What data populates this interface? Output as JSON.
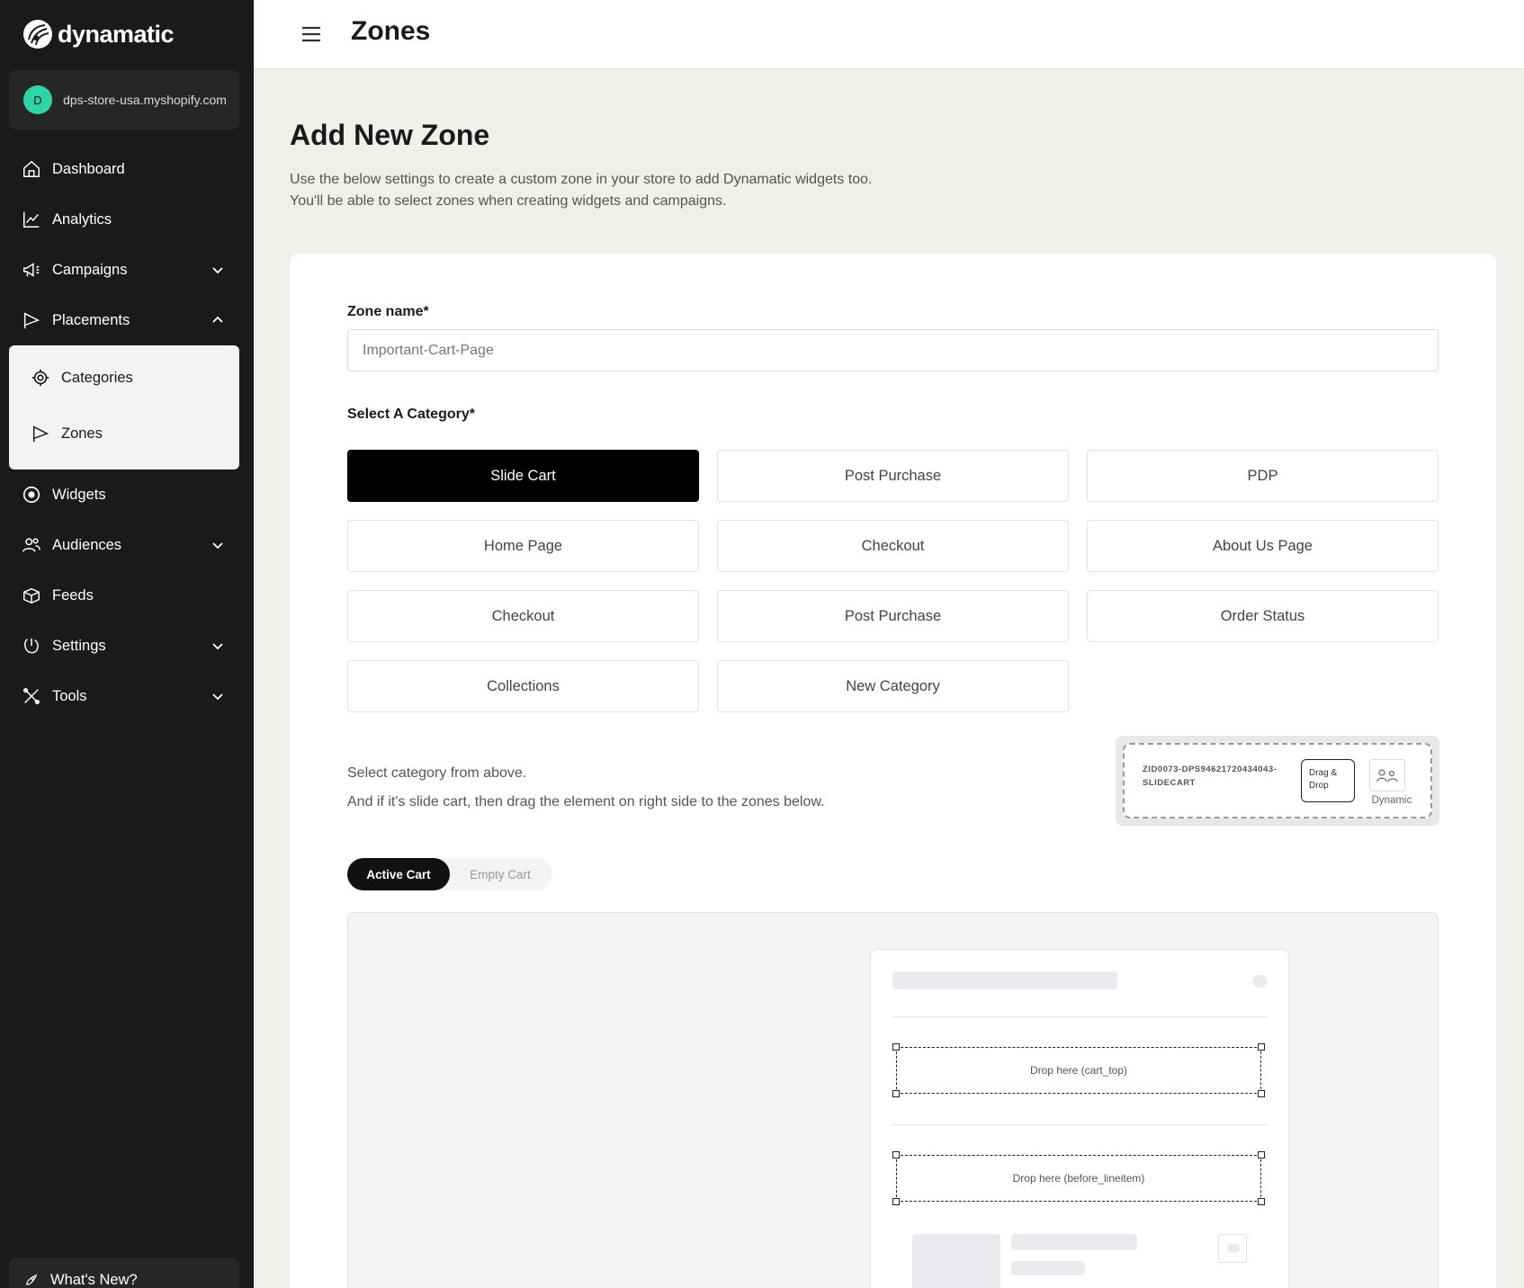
{
  "sidebar": {
    "logo": "dynamatic",
    "store": {
      "avatar": "D",
      "name": "dps-store-usa.myshopify.com"
    },
    "items": [
      {
        "label": "Dashboard",
        "icon": "home-icon"
      },
      {
        "label": "Analytics",
        "icon": "chart-line-icon"
      },
      {
        "label": "Campaigns",
        "icon": "megaphone-icon",
        "expandable": true
      },
      {
        "label": "Placements",
        "icon": "flag-icon",
        "expanded": true
      },
      {
        "label": "Widgets",
        "icon": "target-icon"
      },
      {
        "label": "Audiences",
        "icon": "users-icon",
        "expandable": true
      },
      {
        "label": "Feeds",
        "icon": "package-icon"
      },
      {
        "label": "Settings",
        "icon": "settings-icon",
        "expandable": true
      },
      {
        "label": "Tools",
        "icon": "tools-icon",
        "expandable": true
      }
    ],
    "placements_sub": [
      {
        "label": "Categories",
        "icon": "crosshair-icon"
      },
      {
        "label": "Zones",
        "icon": "flag-icon"
      }
    ],
    "whats_new": "What's New?"
  },
  "topbar": {
    "title": "Zones"
  },
  "page": {
    "title": "Add New Zone",
    "description_1": "Use the below settings to create a custom zone in your store to add Dynamatic widgets too.",
    "description_2": "You'll be able to select zones when creating widgets and campaigns."
  },
  "form": {
    "zone_name_label": "Zone name*",
    "zone_name_value": "Important-Cart-Page",
    "category_label": "Select A Category*",
    "categories": [
      "Slide Cart",
      "Post Purchase",
      "PDP",
      "Home Page",
      "Checkout",
      "About Us Page",
      "Checkout",
      "Post Purchase",
      "Order Status",
      "Collections",
      "New Category"
    ],
    "selected_category": "Slide Cart",
    "hint_1": "Select category from above.",
    "hint_2": "And if it's slide cart, then drag the element on right side to the zones below."
  },
  "drag_element": {
    "id": "ZID0073-DPS94621720434043-SLIDECART",
    "button": "Drag & Drop",
    "brand": "Dynamic"
  },
  "cart_toggle": {
    "active": "Active Cart",
    "empty": "Empty Cart",
    "selected": "Active Cart"
  },
  "preview": {
    "drop_top": "Drop here (cart_top)",
    "drop_before_lineitem": "Drop here (before_lineitem)"
  },
  "colors": {
    "sidebar_bg": "#1a1a1a",
    "accent": "#000000",
    "avatar": "#2fd4a6",
    "page_bg": "#f1efea"
  }
}
